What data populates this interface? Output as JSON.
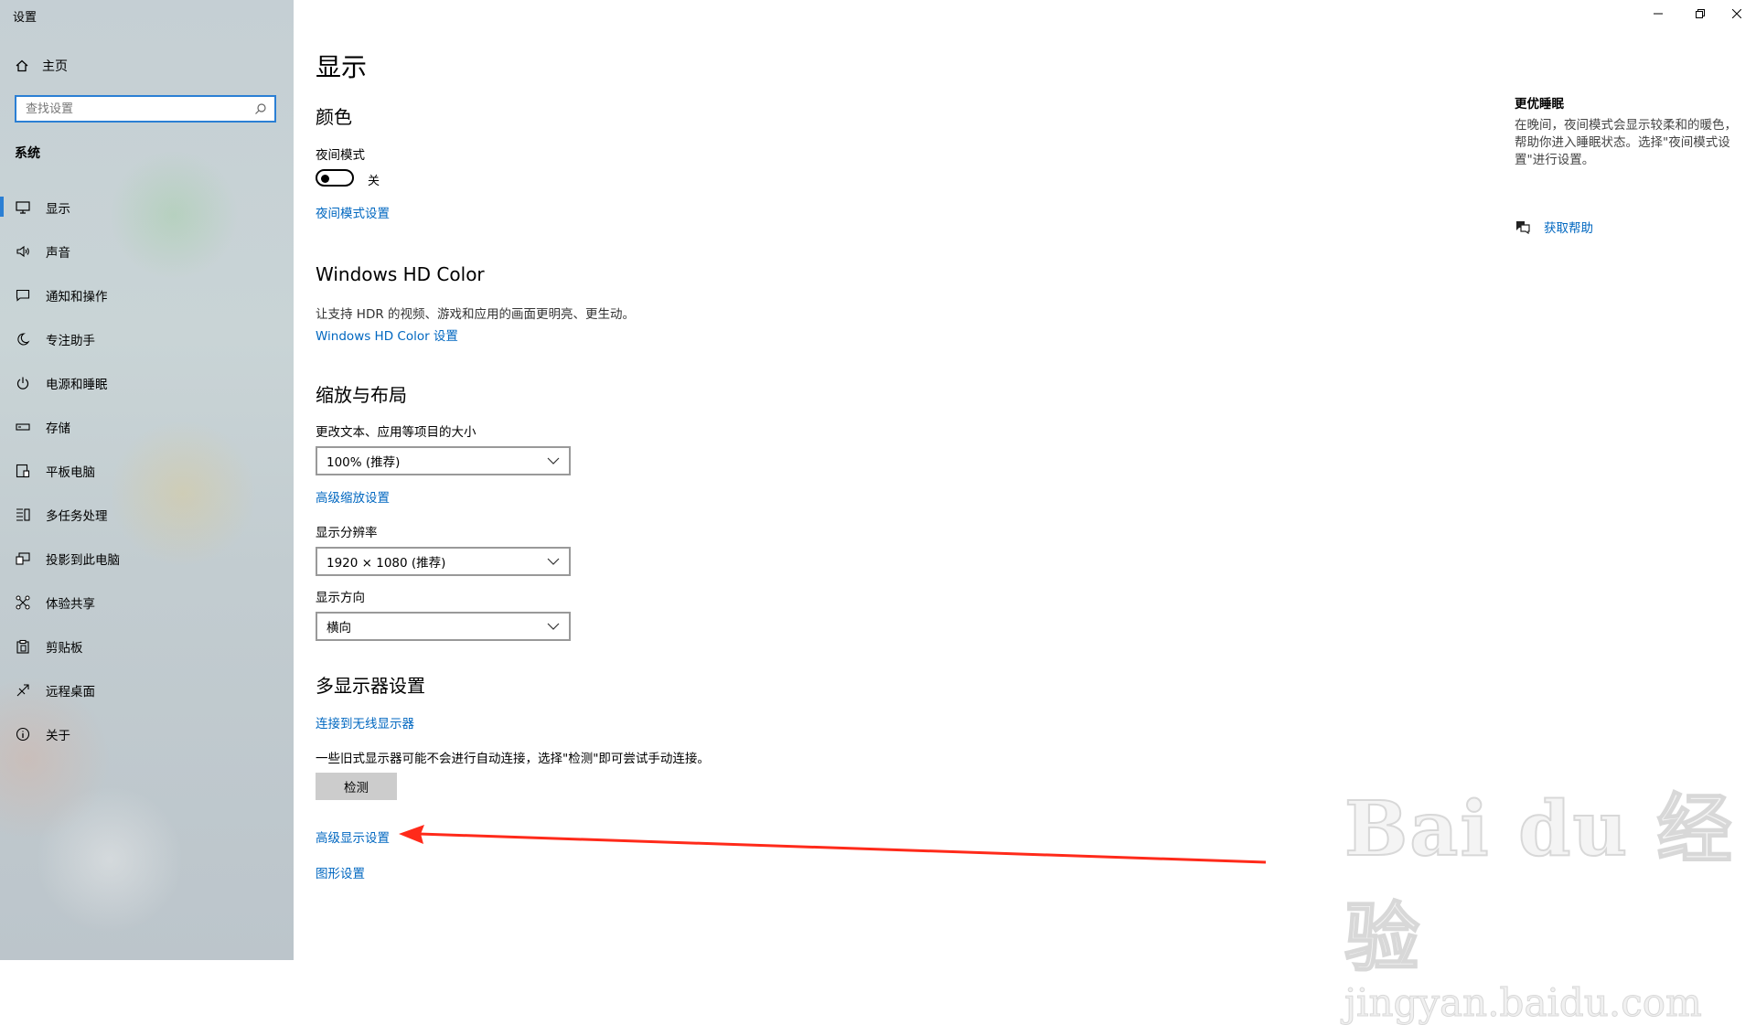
{
  "window": {
    "title": "设置"
  },
  "sidebar": {
    "home_label": "主页",
    "search_placeholder": "查找设置",
    "section": "系统",
    "items": [
      {
        "label": "显示",
        "icon": "monitor-icon"
      },
      {
        "label": "声音",
        "icon": "speaker-icon"
      },
      {
        "label": "通知和操作",
        "icon": "notification-icon"
      },
      {
        "label": "专注助手",
        "icon": "moon-icon"
      },
      {
        "label": "电源和睡眠",
        "icon": "power-icon"
      },
      {
        "label": "存储",
        "icon": "storage-icon"
      },
      {
        "label": "平板电脑",
        "icon": "tablet-icon"
      },
      {
        "label": "多任务处理",
        "icon": "multitask-icon"
      },
      {
        "label": "投影到此电脑",
        "icon": "project-icon"
      },
      {
        "label": "体验共享",
        "icon": "share-icon"
      },
      {
        "label": "剪贴板",
        "icon": "clipboard-icon"
      },
      {
        "label": "远程桌面",
        "icon": "remote-icon"
      },
      {
        "label": "关于",
        "icon": "info-icon"
      }
    ]
  },
  "main": {
    "title": "显示",
    "color": {
      "heading": "颜色",
      "night_light_label": "夜间模式",
      "toggle_state": "关",
      "night_light_link": "夜间模式设置"
    },
    "hdr": {
      "heading": "Windows HD Color",
      "description": "让支持 HDR 的视频、游戏和应用的画面更明亮、更生动。",
      "link": "Windows HD Color 设置"
    },
    "scale": {
      "heading": "缩放与布局",
      "size_label": "更改文本、应用等项目的大小",
      "size_value": "100% (推荐)",
      "advanced_scaling_link": "高级缩放设置",
      "resolution_label": "显示分辨率",
      "resolution_value": "1920 × 1080 (推荐)",
      "orientation_label": "显示方向",
      "orientation_value": "横向"
    },
    "multi": {
      "heading": "多显示器设置",
      "wireless_link": "连接到无线显示器",
      "description": "一些旧式显示器可能不会进行自动连接，选择\"检测\"即可尝试手动连接。",
      "detect_button": "检测",
      "advanced_display_link": "高级显示设置",
      "graphics_link": "图形设置"
    }
  },
  "aside": {
    "heading": "更优睡眠",
    "description": "在晚间，夜间模式会显示较柔和的暖色，帮助你进入睡眠状态。选择\"夜间模式设置\"进行设置。",
    "help_link": "获取帮助"
  },
  "watermark": {
    "line1": "Bai du 经验",
    "line2": "jingyan.baidu.com"
  },
  "annotation_color": "#ff2a1a",
  "accent_color": "#0067c0"
}
